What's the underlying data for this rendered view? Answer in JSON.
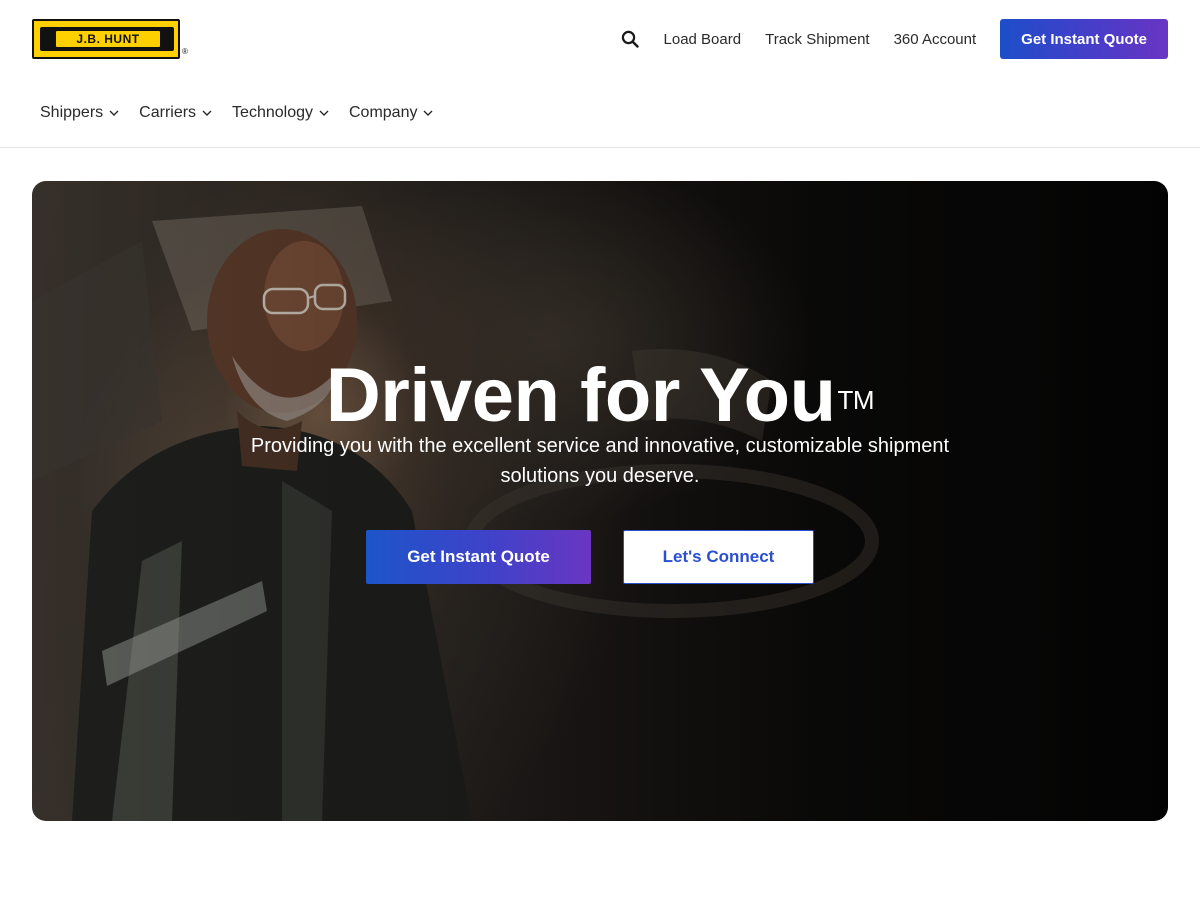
{
  "brand": {
    "logo_text": "J.B. HUNT",
    "logo_mark": "®",
    "colors": {
      "logo_yellow": "#ffd000",
      "primary_blue": "#1d55c9",
      "accent_purple": "#6a36c2"
    }
  },
  "top_nav": {
    "search_icon": "search-icon",
    "links": [
      "Load Board",
      "Track Shipment",
      "360 Account"
    ],
    "cta_label": "Get Instant Quote"
  },
  "main_nav": {
    "items": [
      {
        "label": "Shippers",
        "icon": "chevron-down-icon"
      },
      {
        "label": "Carriers",
        "icon": "chevron-down-icon"
      },
      {
        "label": "Technology",
        "icon": "chevron-down-icon"
      },
      {
        "label": "Company",
        "icon": "chevron-down-icon"
      }
    ]
  },
  "hero": {
    "title": "Driven for You",
    "trademark": "TM",
    "subtitle": "Providing you with the excellent service and innovative, customizable shipment solutions you deserve.",
    "primary_cta": "Get Instant Quote",
    "secondary_cta": "Let's Connect"
  }
}
